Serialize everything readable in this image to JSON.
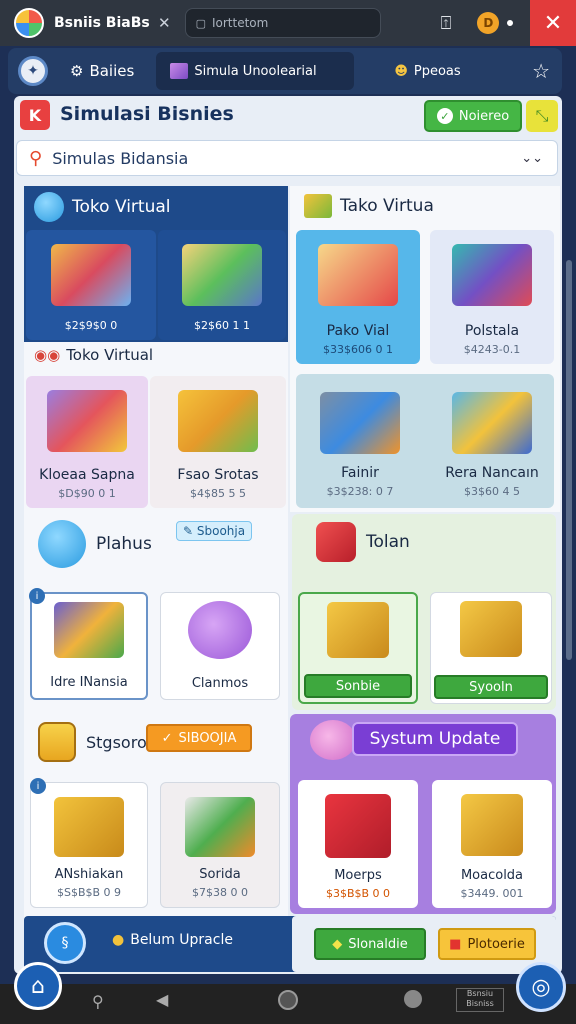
{
  "window": {
    "app_name": "Bsniis BiaBs",
    "address": "Iorttetom",
    "coin_letter": "D",
    "close": "✕"
  },
  "nav": {
    "tab1": "Baiies",
    "tab2": "Simula Unoolearial",
    "tab3": "Ppeoas"
  },
  "header": {
    "title": "Simulasi Bisnies",
    "button": "Noiereo"
  },
  "search": {
    "value": "Simulas Bidansia"
  },
  "toko_left": {
    "title": "Toko Virtual",
    "items": [
      {
        "price": "$2$9$0 0"
      },
      {
        "price": "$2$60 1 1"
      }
    ],
    "subtitle": "Toko Virtual",
    "items2": [
      {
        "name": "Kloeaa Sapna",
        "price": "$D$90 0 1"
      },
      {
        "name": "Fsao Srotas",
        "price": "$4$85 5 5"
      }
    ]
  },
  "toko_right": {
    "title": "Tako Virtua",
    "items": [
      {
        "name": "Pako Vial",
        "price": "$33$606 0 1"
      },
      {
        "name": "Polstala",
        "price": "$4243-0.1"
      },
      {
        "name": "Fainir",
        "price": "$3$238: 0 7"
      },
      {
        "name": "Rera Nancaın",
        "price": "$3$60 4 5"
      }
    ]
  },
  "plahus": {
    "title": "Plahus",
    "badge": "Sboohja",
    "items": [
      {
        "name": "Idre INansia"
      },
      {
        "name": "Clanmos"
      }
    ]
  },
  "tolan": {
    "title": "Tolan",
    "items": [
      {
        "button": "Sonbie"
      },
      {
        "button": "Syooln"
      }
    ]
  },
  "stgsoro": {
    "title": "Stgsoro",
    "badge": "SIBOOJIA",
    "items": [
      {
        "name": "ANshiakan",
        "price": "$S$B$B 0 9"
      },
      {
        "name": "Sorida",
        "price": "$7$38 0 0"
      }
    ]
  },
  "system_update": {
    "title": "Systum Update",
    "items": [
      {
        "name": "Moerps",
        "price": "$3$B$B 0 0"
      },
      {
        "name": "Moacolda",
        "price": "$3449. 001"
      }
    ]
  },
  "bottom": {
    "label": "Belum Upracle",
    "button1": "Slonaldie",
    "button2": "Plotoerie"
  },
  "status_bar": {
    "watermark": "Bsnsiu Bisniss"
  }
}
